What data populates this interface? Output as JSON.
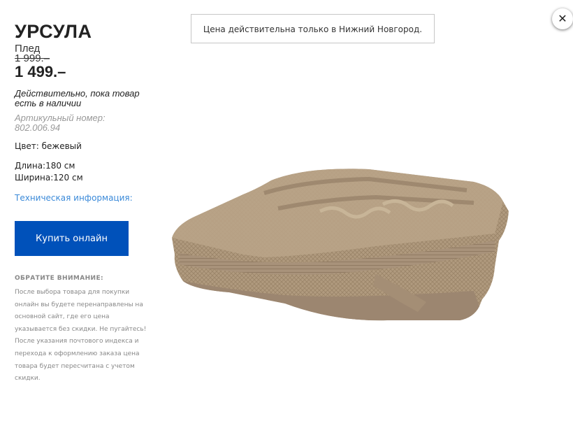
{
  "product": {
    "name": "УРСУЛА",
    "type": "Плед",
    "old_price": "1 999.–",
    "price": "1 499.–",
    "availability": "Действительно, пока товар есть в наличии",
    "article": "Артикульный номер: 802.006.94",
    "color": "Цвет: бежевый",
    "length": "Длина:180 см",
    "width": "Ширина:120 см",
    "tech_link": "Техническая информация:",
    "buy_label": "Купить онлайн",
    "note_heading": "ОБРАТИТЕ ВНИМАНИЕ:",
    "note_text": "После выбора товара для покупки онлайн вы будете перенаправлены на основной сайт, где его цена указывается без скидки. Не пугайтесь! После указания почтового индекса и перехода к оформлению заказа цена товара будет пересчитана с учетом скидки."
  },
  "price_notice": "Цена действительна только в Нижний Новгород.",
  "close_icon": "close-icon",
  "image": "folded-knitted-blanket",
  "colors": {
    "button": "#0051ba",
    "link": "#3b8ad9",
    "blanket": "#b09a7e"
  }
}
